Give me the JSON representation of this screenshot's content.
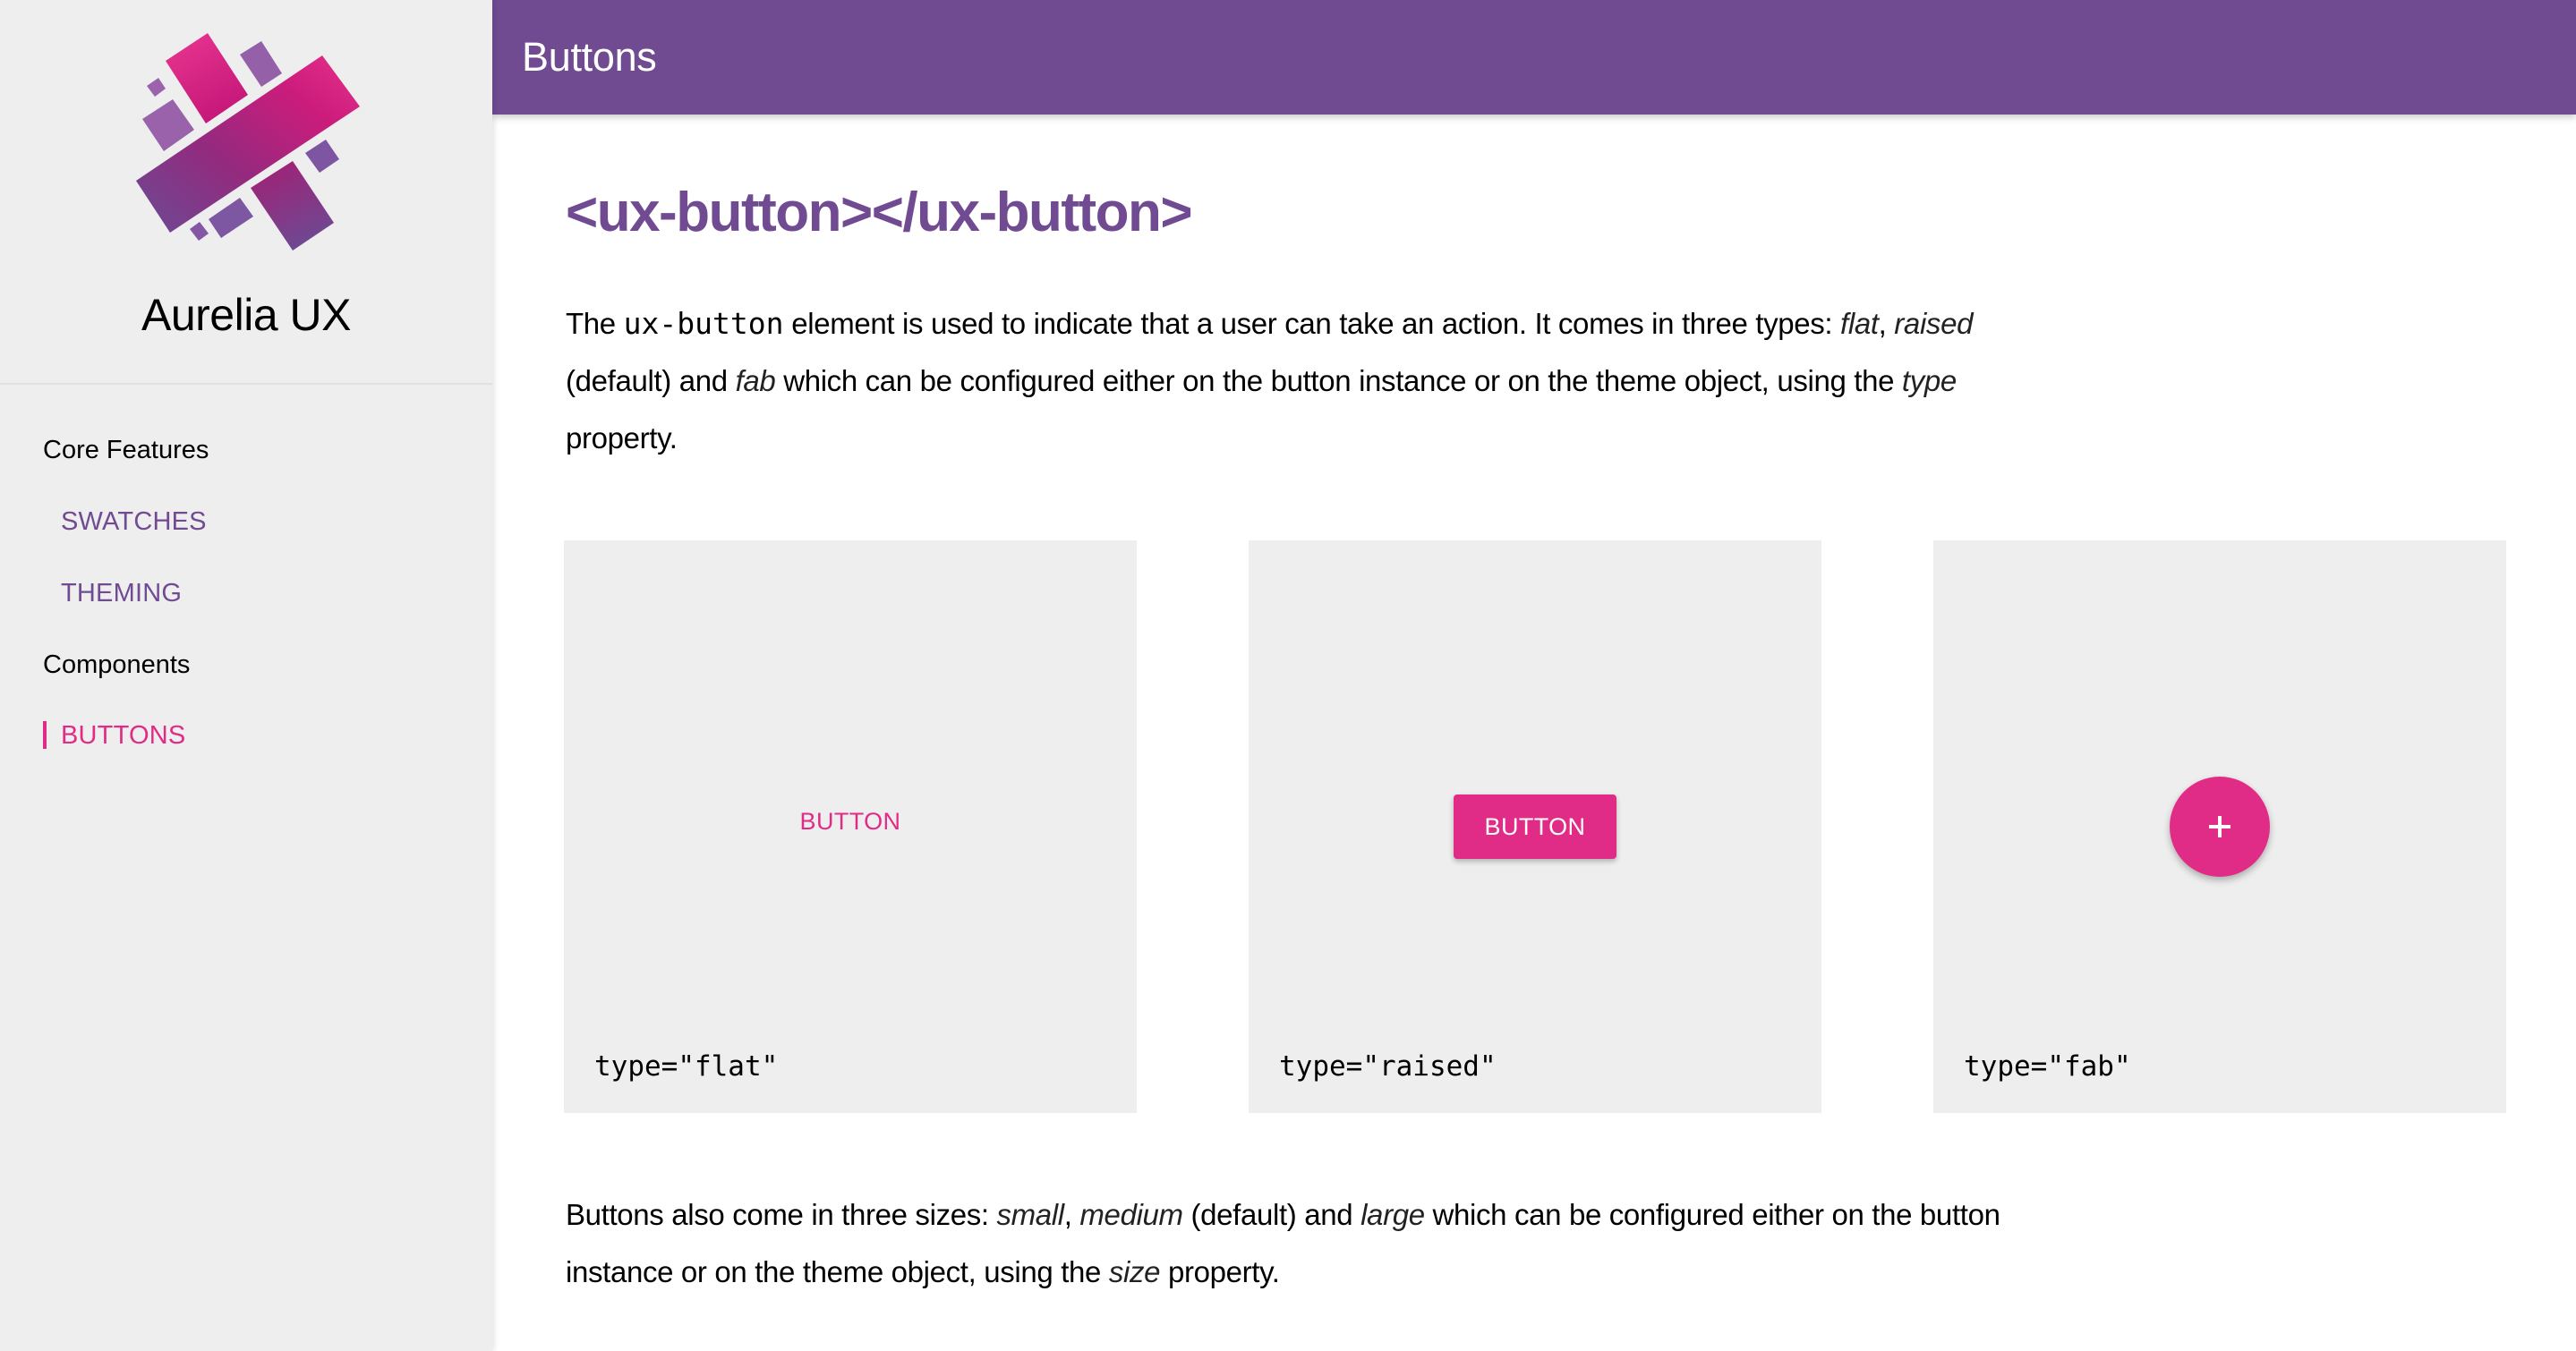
{
  "sidebar": {
    "brand": "Aurelia UX",
    "nav": [
      {
        "label": "Core Features",
        "kind": "section"
      },
      {
        "label": "SWATCHES",
        "kind": "link",
        "active": false
      },
      {
        "label": "THEMING",
        "kind": "link",
        "active": false
      },
      {
        "label": "Components",
        "kind": "section"
      },
      {
        "label": "BUTTONS",
        "kind": "link",
        "active": true
      }
    ]
  },
  "header": {
    "title": "Buttons"
  },
  "main": {
    "heading": "<ux-button></ux-button>",
    "intro": {
      "l1_a": "The ",
      "l1_code": "ux-button",
      "l1_b": " element is used to indicate that a user can take an action. It comes in three types: ",
      "l1_em1": "flat",
      "l1_c": ", ",
      "l1_em2": "raised",
      "l2_a": "(default) and ",
      "l2_em": "fab",
      "l2_b": " which can be configured either on the button instance or on the theme object, using the ",
      "l2_em2": "type",
      "l3": "property."
    },
    "demos": [
      {
        "button_label": "BUTTON",
        "caption": "type=\"flat\""
      },
      {
        "button_label": "BUTTON",
        "caption": "type=\"raised\""
      },
      {
        "button_icon": "plus-icon",
        "caption": "type=\"fab\""
      }
    ],
    "sizes": {
      "l1_a": "Buttons also come in three sizes: ",
      "l1_em1": "small",
      "l1_b": ", ",
      "l1_em2": "medium",
      "l1_c": " (default) and ",
      "l1_em3": "large",
      "l1_d": " which can be configured either on the button",
      "l2_a": "instance or on the theme object, using the ",
      "l2_em": "size",
      "l2_b": " property."
    }
  },
  "colors": {
    "primary": "#714b92",
    "accent": "#e12c87",
    "sidebar_bg": "#eeeeee",
    "card_bg": "#eeeeee"
  }
}
